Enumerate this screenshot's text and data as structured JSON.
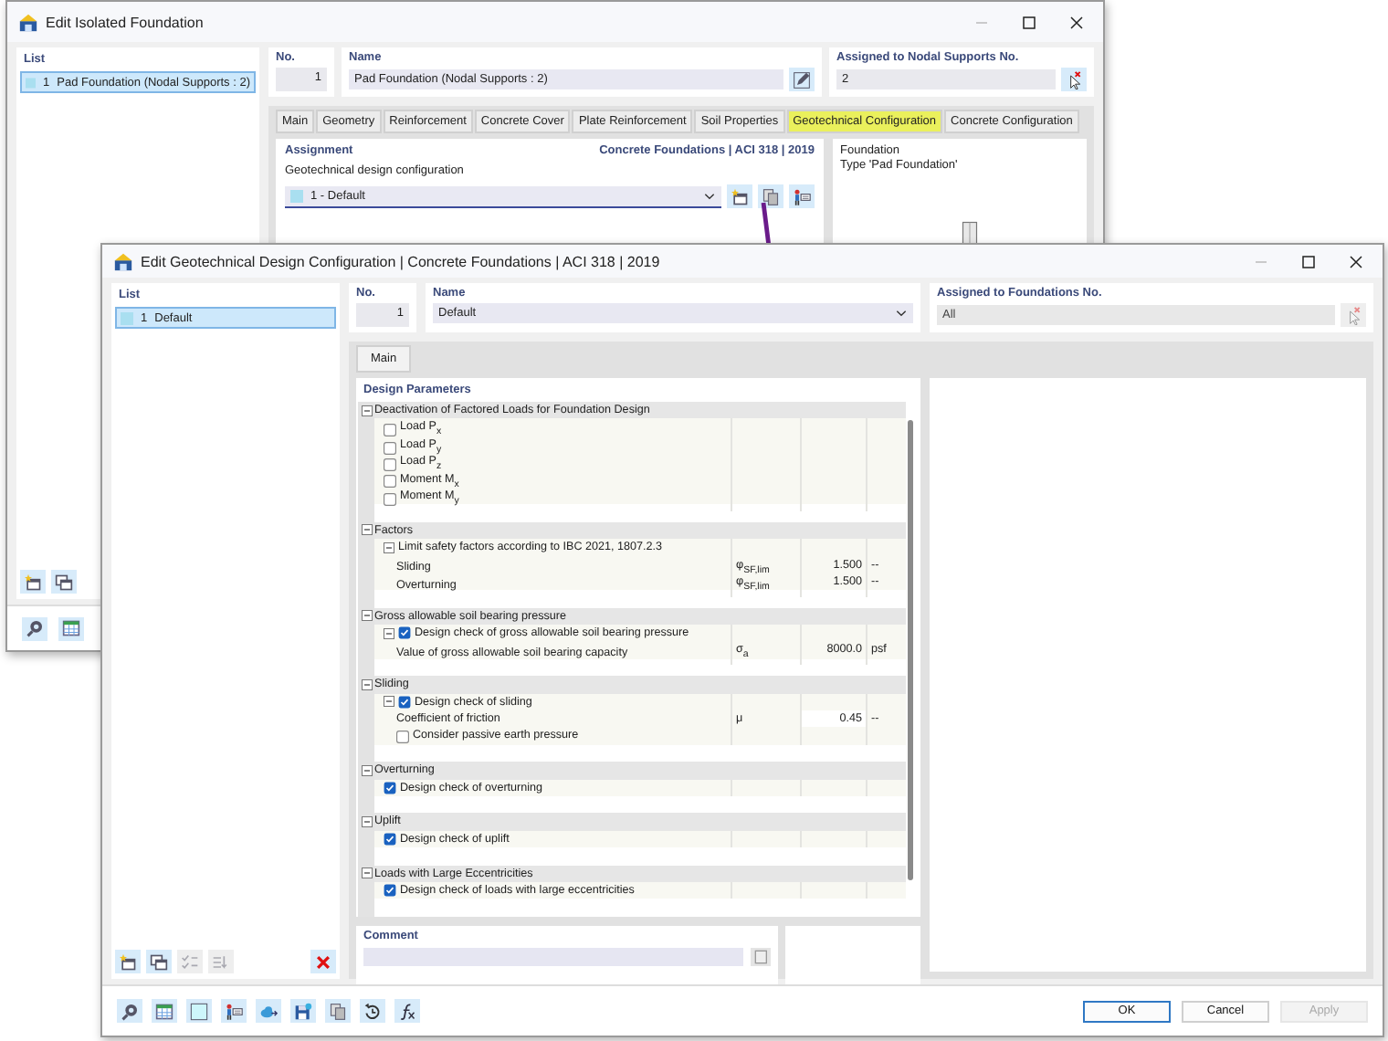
{
  "back_window": {
    "title": "Edit Isolated Foundation",
    "list": {
      "header": "List",
      "items": [
        {
          "number": "1",
          "label": "Pad Foundation (Nodal Supports : 2)",
          "selected": true
        }
      ]
    },
    "list_toolbar": [
      {
        "kind": "new",
        "disabled": false
      },
      {
        "kind": "copy",
        "disabled": false
      }
    ],
    "bottom_toolbar": [
      {
        "kind": "help"
      },
      {
        "kind": "table"
      }
    ],
    "no": {
      "label": "No.",
      "value": "1"
    },
    "name": {
      "label": "Name",
      "value": "Pad Foundation (Nodal Supports : 2)"
    },
    "assigned": {
      "label": "Assigned to Nodal Supports No.",
      "value": "2",
      "disabled": false
    },
    "tabs": [
      {
        "label": "Main",
        "selected": false
      },
      {
        "label": "Geometry",
        "selected": false
      },
      {
        "label": "Reinforcement",
        "selected": false
      },
      {
        "label": "Concrete Cover",
        "selected": false
      },
      {
        "label": "Plate Reinforcement",
        "selected": false
      },
      {
        "label": "Soil Properties",
        "selected": false
      },
      {
        "label": "Geotechnical Configuration",
        "selected": true
      },
      {
        "label": "Concrete Configuration",
        "selected": false
      }
    ],
    "assignment": {
      "title": "Assignment",
      "standard": "Concrete Foundations | ACI 318 | 2019",
      "field_label": "Geotechnical design configuration",
      "value": "1 - Default"
    },
    "preview": {
      "lines": [
        "Foundation",
        "Type 'Pad Foundation'"
      ]
    }
  },
  "front_window": {
    "title": "Edit Geotechnical Design Configuration | Concrete Foundations | ACI 318 | 2019",
    "list": {
      "header": "List",
      "items": [
        {
          "number": "1",
          "label": "Default",
          "selected": true
        }
      ]
    },
    "list_toolbar": [
      {
        "kind": "new",
        "disabled": false
      },
      {
        "kind": "copy",
        "disabled": false
      },
      {
        "kind": "check",
        "disabled": true
      },
      {
        "kind": "sort",
        "disabled": true
      },
      {
        "kind": "delete",
        "disabled": false
      }
    ],
    "no": {
      "label": "No.",
      "value": "1"
    },
    "name": {
      "label": "Name",
      "value": "Default"
    },
    "assigned": {
      "label": "Assigned to Foundations No.",
      "value": "All",
      "disabled": true
    },
    "tabs": [
      {
        "label": "Main",
        "selected": true
      }
    ],
    "section": "Design Parameters",
    "tree": [
      {
        "title": "Deactivation of Factored Loads for Foundation Design",
        "expanded": true,
        "children": [
          {
            "kind": "check",
            "label": "Load P$_{x}$",
            "checked": false
          },
          {
            "kind": "check",
            "label": "Load P$_{y}$",
            "checked": false
          },
          {
            "kind": "check",
            "label": "Load P$_{z}$",
            "checked": false
          },
          {
            "kind": "check",
            "label": "Moment M$_{x}$",
            "checked": false
          },
          {
            "kind": "check",
            "label": "Moment M$_{y}$",
            "checked": false
          }
        ]
      },
      {
        "title": "Factors",
        "expanded": true,
        "children": [
          {
            "kind": "node",
            "label": "Limit safety factors according to IBC 2021, 1807.2.3",
            "expanded": true,
            "children": [
              {
                "kind": "value",
                "label": "Sliding",
                "symbol": "φ$_{SF,lim}$",
                "value": "1.500",
                "unit": "--",
                "editable": false
              },
              {
                "kind": "value",
                "label": "Overturning",
                "symbol": "φ$_{SF,lim}$",
                "value": "1.500",
                "unit": "--",
                "editable": false
              }
            ]
          }
        ]
      },
      {
        "title": "Gross allowable soil bearing pressure",
        "expanded": true,
        "children": [
          {
            "kind": "check",
            "label": "Design check of gross allowable soil bearing pressure",
            "checked": true,
            "expanded": true,
            "children": [
              {
                "kind": "value",
                "label": "Value of gross allowable soil bearing capacity",
                "symbol": "σ$_{a}$",
                "value": "8000.0",
                "unit": "psf",
                "editable": false
              }
            ]
          }
        ]
      },
      {
        "title": "Sliding",
        "expanded": true,
        "children": [
          {
            "kind": "check",
            "label": "Design check of sliding",
            "checked": true,
            "expanded": true,
            "children": [
              {
                "kind": "value",
                "label": "Coefficient of friction",
                "symbol": "μ",
                "value": "0.45",
                "unit": "--",
                "editable": true
              },
              {
                "kind": "check",
                "label": "Consider passive earth pressure",
                "checked": false
              }
            ]
          }
        ]
      },
      {
        "title": "Overturning",
        "expanded": true,
        "children": [
          {
            "kind": "check",
            "label": "Design check of overturning",
            "checked": true
          }
        ]
      },
      {
        "title": "Uplift",
        "expanded": true,
        "children": [
          {
            "kind": "check",
            "label": "Design check of uplift",
            "checked": true
          }
        ]
      },
      {
        "title": "Loads with Large Eccentricities",
        "expanded": true,
        "children": [
          {
            "kind": "check",
            "label": "Design check of loads with large eccentricities",
            "checked": true
          }
        ]
      }
    ],
    "comment": {
      "label": "Comment"
    },
    "bottom_toolbar": [
      {
        "kind": "help"
      },
      {
        "kind": "table"
      },
      {
        "kind": "blank"
      },
      {
        "kind": "person"
      },
      {
        "kind": "cloud"
      },
      {
        "kind": "save"
      },
      {
        "kind": "docs"
      },
      {
        "kind": "reset"
      },
      {
        "kind": "fx"
      }
    ],
    "buttons": [
      {
        "label": "OK",
        "default": true,
        "disabled": false
      },
      {
        "label": "Cancel",
        "default": false,
        "disabled": false
      },
      {
        "label": "Apply",
        "default": false,
        "disabled": true
      }
    ]
  }
}
